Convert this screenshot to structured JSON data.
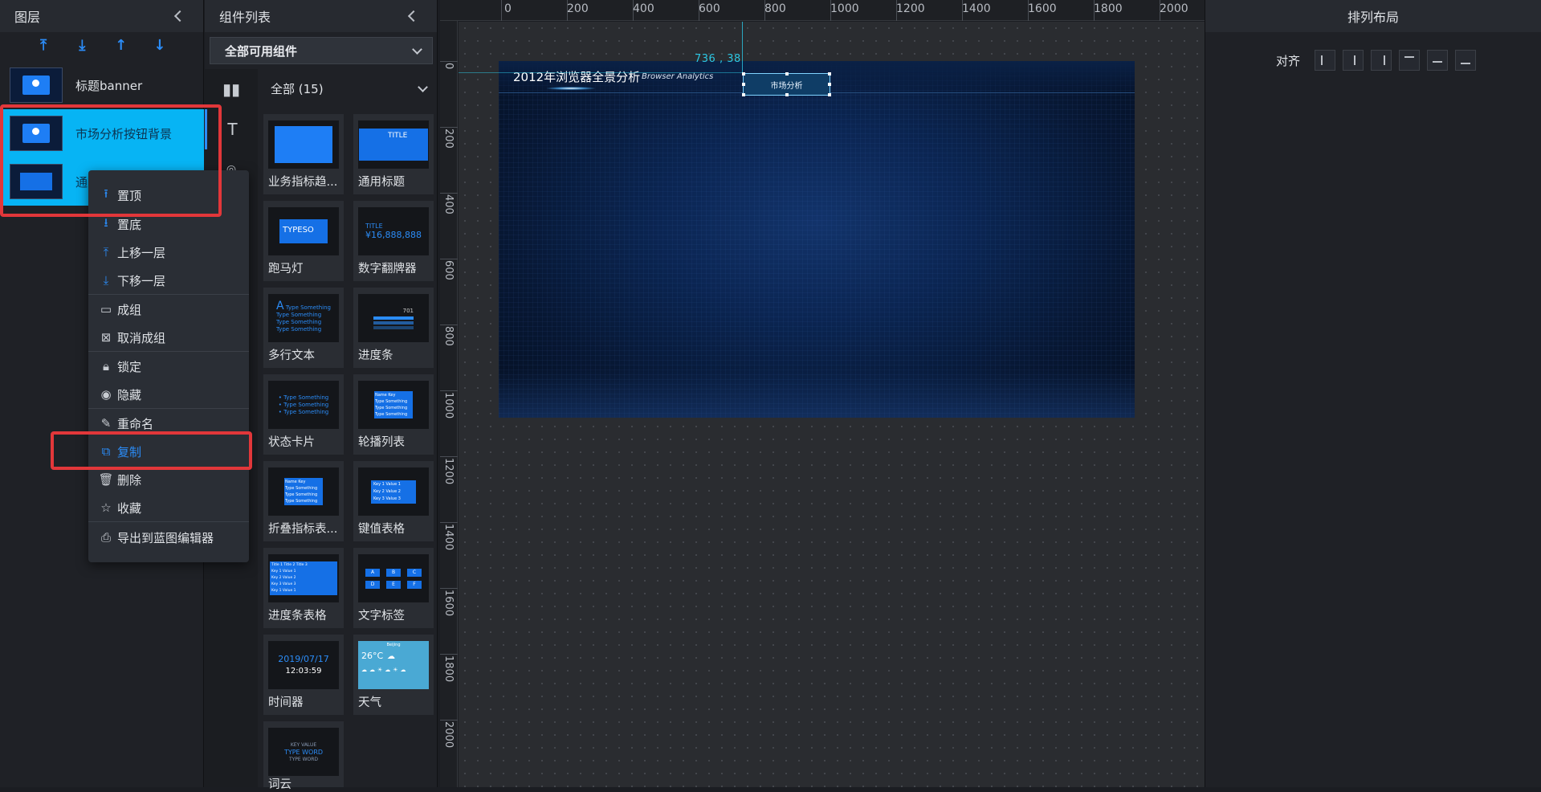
{
  "layers": {
    "title": "图层",
    "items": [
      {
        "label": "标题banner"
      },
      {
        "label": "市场分析按钮背景"
      },
      {
        "label": "通"
      }
    ]
  },
  "context_menu": {
    "items": [
      {
        "label": "置顶",
        "icon": "arrow-top-icon"
      },
      {
        "label": "置底",
        "icon": "arrow-bottom-icon"
      },
      {
        "label": "上移一层",
        "icon": "move-up-icon"
      },
      {
        "label": "下移一层",
        "icon": "move-down-icon"
      },
      {
        "label": "成组",
        "icon": "folder-icon"
      },
      {
        "label": "取消成组",
        "icon": "ungroup-icon"
      },
      {
        "label": "锁定",
        "icon": "lock-icon"
      },
      {
        "label": "隐藏",
        "icon": "eye-icon"
      },
      {
        "label": "重命名",
        "icon": "pencil-icon"
      },
      {
        "label": "复制",
        "icon": "copy-icon"
      },
      {
        "label": "删除",
        "icon": "trash-icon"
      },
      {
        "label": "收藏",
        "icon": "star-icon"
      },
      {
        "label": "导出到蓝图编辑器",
        "icon": "export-icon"
      }
    ],
    "active": "复制"
  },
  "components": {
    "title": "组件列表",
    "filter": "全部可用组件",
    "category": "全部 (15)",
    "cards": [
      {
        "label": "业务指标趋..."
      },
      {
        "label": "通用标题",
        "thumb": "TITLE"
      },
      {
        "label": "跑马灯",
        "thumb": "TYPESO"
      },
      {
        "label": "数字翻牌器",
        "thumb_title": "TITLE",
        "thumb_value": "¥16,888,888"
      },
      {
        "label": "多行文本",
        "thumb": "A",
        "thumb_lines": [
          "Type Something",
          "Type Something",
          "Type Something",
          "Type Something"
        ]
      },
      {
        "label": "进度条",
        "thumb": "701"
      },
      {
        "label": "状态卡片",
        "thumb_lines": [
          "Type Something",
          "Type Something",
          "Type Something"
        ]
      },
      {
        "label": "轮播列表",
        "thumb_head": [
          "Name",
          "Key"
        ],
        "thumb_rows": [
          "Type Something",
          "Type Something",
          "Type Something"
        ]
      },
      {
        "label": "折叠指标表...",
        "thumb_head": [
          "Name",
          "Key"
        ],
        "thumb_rows": [
          "Type Something",
          "Type Something",
          "Type Something"
        ]
      },
      {
        "label": "键值表格",
        "thumb_rows": [
          [
            "Key 1",
            "Value 1"
          ],
          [
            "Key 2",
            "Value 2"
          ],
          [
            "Key 3",
            "Value 3"
          ]
        ]
      },
      {
        "label": "进度条表格",
        "thumb_head": [
          "Title 1",
          "Title 2",
          "Title 3"
        ],
        "thumb_rows": [
          [
            "Key 1",
            "Value 1"
          ],
          [
            "Key 2",
            "Value 2"
          ],
          [
            "Key 3",
            "Value 3"
          ],
          [
            "Key 1",
            "Value 1"
          ]
        ]
      },
      {
        "label": "文字标签",
        "thumb_tags": [
          "A",
          "B",
          "C",
          "D",
          "E",
          "F"
        ]
      },
      {
        "label": "时间器",
        "thumb_date": "2019/07/17",
        "thumb_time": "12:03:59"
      },
      {
        "label": "天气",
        "thumb_temp": "26°C",
        "thumb_city": "Beijing"
      },
      {
        "label": "词云",
        "thumb_words": [
          "KEY VALUE",
          "TYPE WORD",
          "TYPE WORD"
        ]
      }
    ]
  },
  "ruler": {
    "top": [
      "0",
      "200",
      "400",
      "600",
      "800",
      "1000",
      "1200",
      "1400",
      "1600",
      "1800",
      "2000"
    ],
    "left": [
      "0",
      "200",
      "400",
      "600",
      "800",
      "1000",
      "1200",
      "1400",
      "1600",
      "1800",
      "2000"
    ]
  },
  "canvas": {
    "coord": "736 , 38",
    "screen_title": "2012年浏览器全景分析",
    "screen_subtitle": "Browser Analytics",
    "selected_button": "市场分析"
  },
  "right_panel": {
    "title": "排列布局",
    "align_label": "对齐",
    "align_buttons": [
      "align-left-icon",
      "align-center-h-icon",
      "align-right-icon",
      "align-top-icon",
      "align-middle-v-icon",
      "align-bottom-icon"
    ]
  },
  "colors": {
    "accent": "#2b8cf7",
    "selection": "#07b4f4",
    "highlight_box": "#e2373a",
    "guide": "#2cc7e4"
  }
}
